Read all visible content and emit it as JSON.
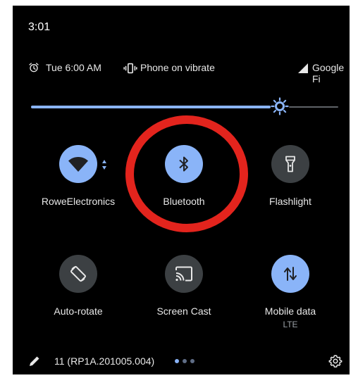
{
  "status_bar": {
    "time": "3:01"
  },
  "header": {
    "alarm_icon": "alarm-clock-icon",
    "alarm_text": "Tue 6:00 AM",
    "vibrate_icon": "vibrate-icon",
    "ringer_text": "Phone on vibrate",
    "signal_icon": "cell-signal-icon",
    "carrier": "Google Fi"
  },
  "brightness": {
    "level": 0.81,
    "icon": "brightness-sun-icon"
  },
  "tiles": [
    {
      "label": "RoweElectronics",
      "sublabel": "",
      "state": "on",
      "icon": "wifi-icon"
    },
    {
      "label": "Bluetooth",
      "sublabel": "",
      "state": "on",
      "icon": "bluetooth-icon"
    },
    {
      "label": "Flashlight",
      "sublabel": "",
      "state": "off",
      "icon": "flashlight-icon"
    },
    {
      "label": "Auto-rotate",
      "sublabel": "",
      "state": "off",
      "icon": "auto-rotate-icon"
    },
    {
      "label": "Screen Cast",
      "sublabel": "",
      "state": "off",
      "icon": "cast-icon"
    },
    {
      "label": "Mobile data",
      "sublabel": "LTE",
      "state": "on",
      "icon": "mobile-data-icon"
    }
  ],
  "footer": {
    "edit_icon": "pencil-edit-icon",
    "build": "11 (RP1A.201005.004)",
    "page_count": 3,
    "active_page": 0,
    "settings_icon": "gear-icon"
  },
  "colors": {
    "accent": "#8ab4f8",
    "tile_off": "#3c4043",
    "annotation_ring": "#e3241d",
    "background": "#000000"
  }
}
